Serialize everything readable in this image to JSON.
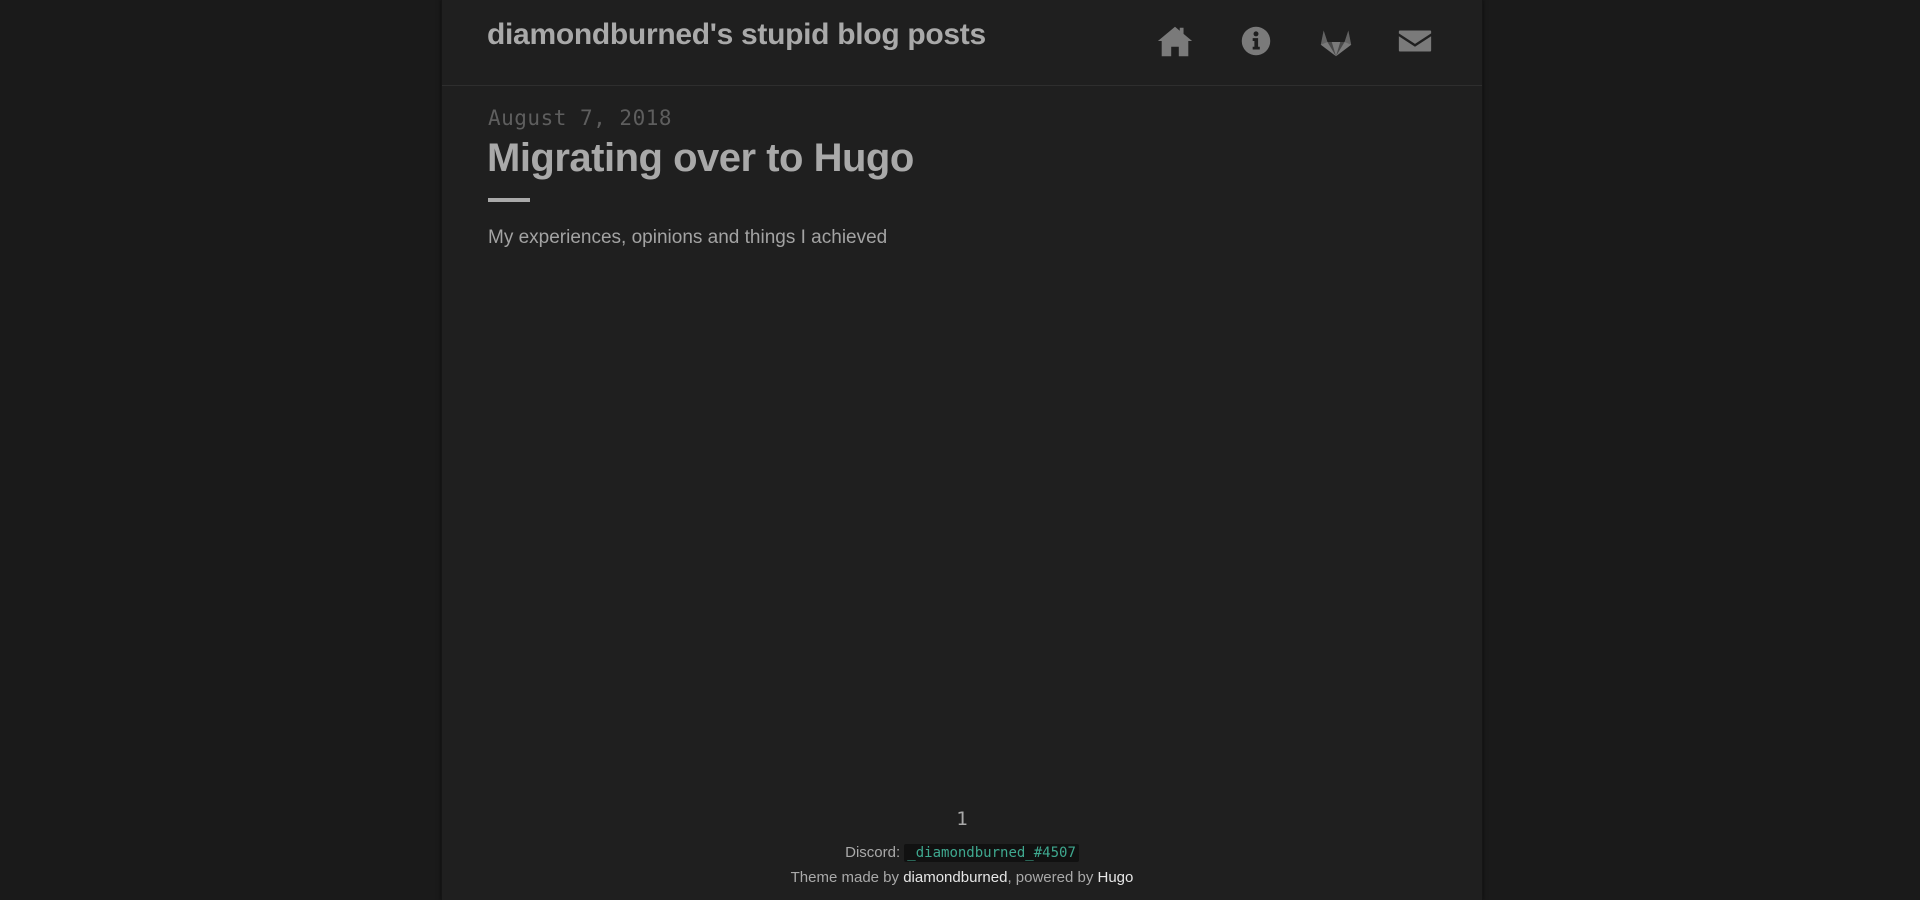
{
  "header": {
    "site_title": "diamondburned's stupid blog posts",
    "nav": [
      {
        "icon": "home-icon"
      },
      {
        "icon": "info-icon"
      },
      {
        "icon": "gitlab-icon"
      },
      {
        "icon": "envelope-icon"
      }
    ]
  },
  "post": {
    "date": "August 7, 2018",
    "title": "Migrating over to Hugo",
    "summary": "My experiences, opinions and things I achieved"
  },
  "pagination": {
    "current": "1"
  },
  "footer": {
    "discord_label": "Discord:",
    "discord_tag": "_diamondburned_#4507",
    "theme_prefix": "Theme made by ",
    "theme_author": "diamondburned",
    "powered_prefix": ", powered by ",
    "powered_by": "Hugo"
  },
  "colors": {
    "background": "#1a1a1a",
    "panel": "#1f1f1f",
    "text": "#a9a9a9",
    "date": "#5e5e5e",
    "icon": "#7a7a7a",
    "discord_tag": "#3fa88f"
  }
}
